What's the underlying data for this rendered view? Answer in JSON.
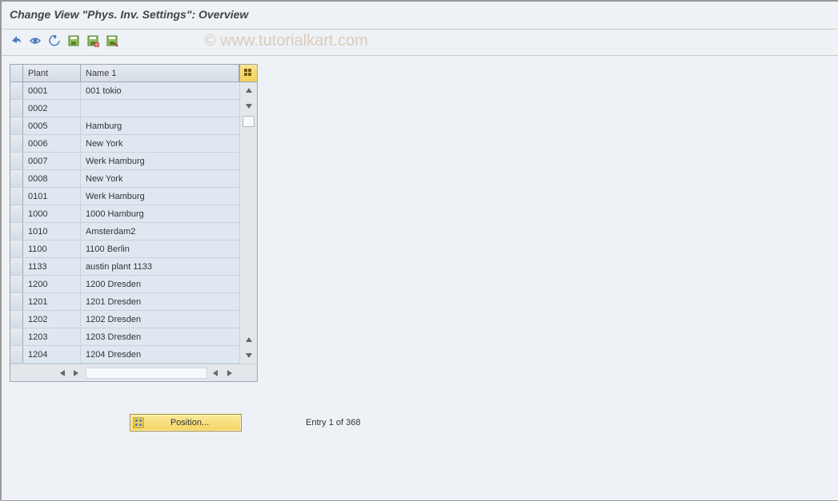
{
  "title": "Change View \"Phys. Inv. Settings\": Overview",
  "watermark": "© www.tutorialkart.com",
  "toolbar": {
    "buttons": [
      "undo-icon",
      "details-icon",
      "back-icon",
      "save-icon",
      "save2-icon",
      "save3-icon"
    ]
  },
  "grid": {
    "headers": {
      "plant": "Plant",
      "name": "Name 1"
    },
    "rows": [
      {
        "plant": "0001",
        "name": "001 tokio"
      },
      {
        "plant": "0002",
        "name": ""
      },
      {
        "plant": "0005",
        "name": "Hamburg"
      },
      {
        "plant": "0006",
        "name": "New York"
      },
      {
        "plant": "0007",
        "name": "Werk Hamburg"
      },
      {
        "plant": "0008",
        "name": "New York"
      },
      {
        "plant": "0101",
        "name": "Werk Hamburg"
      },
      {
        "plant": "1000",
        "name": "1000 Hamburg"
      },
      {
        "plant": "1010",
        "name": "Amsterdam2"
      },
      {
        "plant": "1100",
        "name": "1100 Berlin"
      },
      {
        "plant": "1133",
        "name": "austin plant 1133"
      },
      {
        "plant": "1200",
        "name": "1200 Dresden"
      },
      {
        "plant": "1201",
        "name": "1201 Dresden"
      },
      {
        "plant": "1202",
        "name": "1202 Dresden"
      },
      {
        "plant": "1203",
        "name": "1203 Dresden"
      },
      {
        "plant": "1204",
        "name": "1204 Dresden"
      }
    ]
  },
  "footer": {
    "position_label": "Position...",
    "entry_text": "Entry 1 of 368"
  }
}
